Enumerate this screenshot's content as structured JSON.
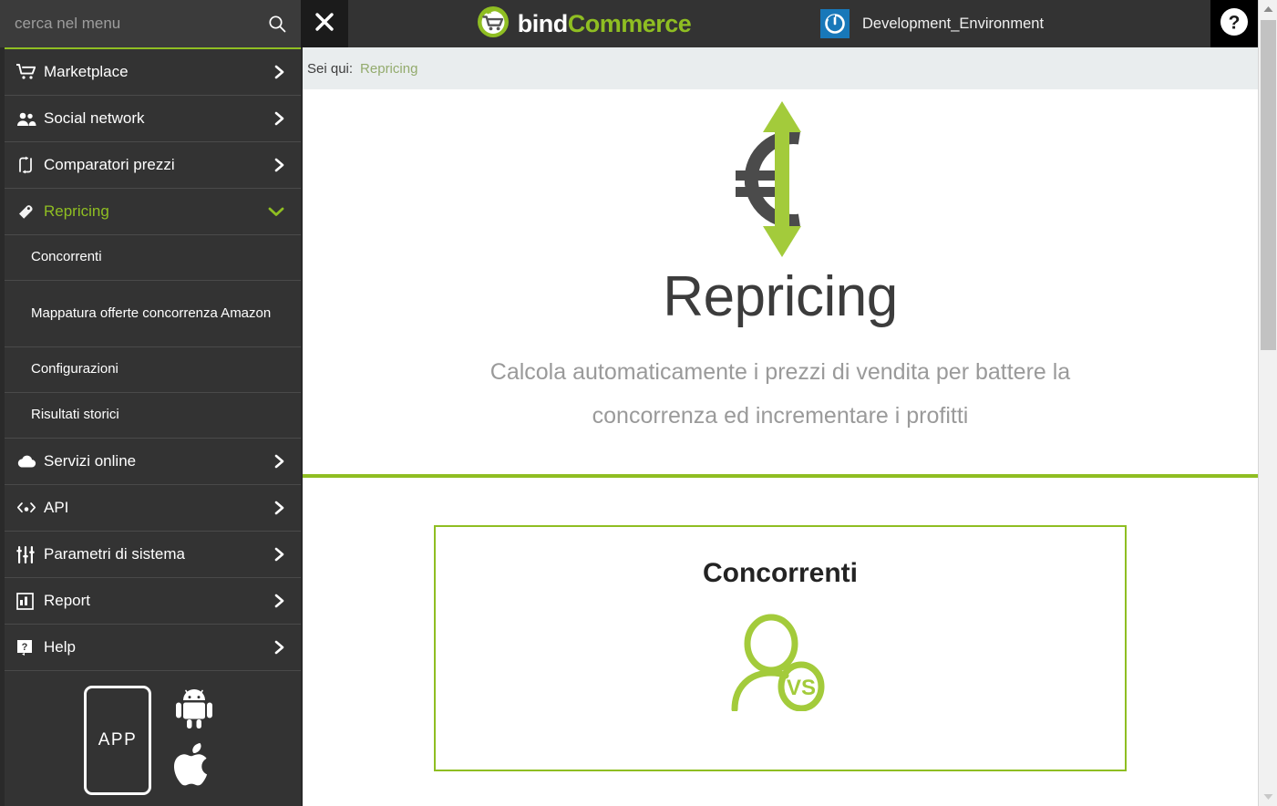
{
  "topbar": {
    "search_placeholder": "cerca nel menu",
    "search_value": "",
    "search_icon": "search-icon",
    "close_icon": "close-icon",
    "logo_bind": "bind",
    "logo_commerce": "Commerce",
    "environment_label": "Development_Environment",
    "help_icon": "question-mark-icon"
  },
  "sidebar": {
    "items": [
      {
        "label": "Marketplace",
        "icon": "shopping-cart-icon",
        "chevron": "chevron-right-icon",
        "active": false
      },
      {
        "label": "Social network",
        "icon": "users-group-icon",
        "chevron": "chevron-right-icon",
        "active": false
      },
      {
        "label": "Comparatori prezzi",
        "icon": "compare-arrows-icon",
        "chevron": "chevron-right-icon",
        "active": false
      },
      {
        "label": "Repricing",
        "icon": "price-tag-icon",
        "chevron": "chevron-down-icon",
        "active": true
      }
    ],
    "submenu": [
      {
        "label": "Concorrenti"
      },
      {
        "label": "Mappatura offerte concorrenza Amazon"
      },
      {
        "label": "Configurazioni"
      },
      {
        "label": "Risultati storici"
      }
    ],
    "items_lower": [
      {
        "label": "Servizi online",
        "icon": "cloud-icon",
        "chevron": "chevron-right-icon"
      },
      {
        "label": "API",
        "icon": "code-gear-icon",
        "chevron": "chevron-right-icon"
      },
      {
        "label": "Parametri di sistema",
        "icon": "sliders-icon",
        "chevron": "chevron-right-icon"
      },
      {
        "label": "Report",
        "icon": "report-chart-icon",
        "chevron": "chevron-right-icon"
      },
      {
        "label": "Help",
        "icon": "help-square-icon",
        "chevron": "chevron-right-icon"
      }
    ],
    "app_promo": {
      "phone_label": "APP",
      "android_icon": "android-icon",
      "apple_icon": "apple-icon"
    }
  },
  "content": {
    "breadcrumb_label": "Sei qui:",
    "breadcrumb_current": "Repricing",
    "hero_icon": "euro-updown-arrow-icon",
    "hero_title": "Repricing",
    "hero_subtitle": "Calcola automaticamente i prezzi di vendita per battere la concorrenza ed incrementare i profitti",
    "card": {
      "title": "Concorrenti",
      "icon": "competitor-vs-person-icon"
    }
  },
  "scrollbar": {
    "up_icon": "scroll-up-arrow-icon",
    "down_icon": "scroll-down-arrow-icon"
  },
  "colors": {
    "accent_green": "#8fbe22",
    "sidebar_bg": "#333333",
    "topbar_bg": "#333333",
    "breadcrumb_bg": "#e9edee",
    "env_blue": "#1878b9"
  }
}
